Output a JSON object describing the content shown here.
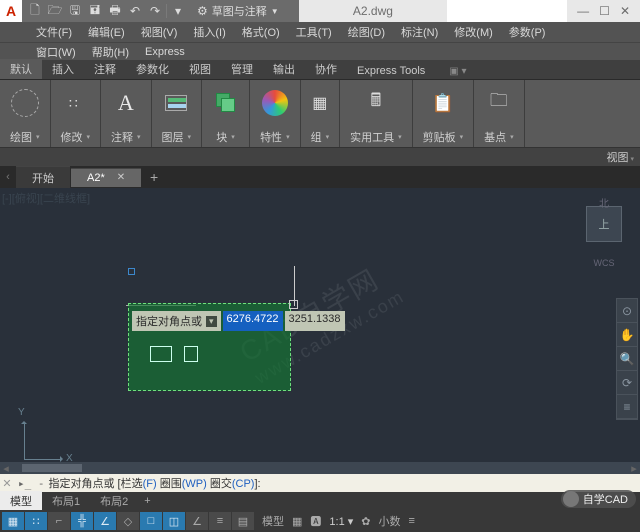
{
  "titlebar": {
    "mode_label": "草图与注释",
    "filename": "A2.dwg",
    "search_placeholder": ""
  },
  "menubar": {
    "items": [
      "文件(F)",
      "编辑(E)",
      "视图(V)",
      "插入(I)",
      "格式(O)",
      "工具(T)",
      "绘图(D)",
      "标注(N)",
      "修改(M)",
      "参数(P)"
    ],
    "row2": [
      "窗口(W)",
      "帮助(H)",
      "Express"
    ]
  },
  "ribbon": {
    "tabs": [
      "默认",
      "插入",
      "注释",
      "参数化",
      "视图",
      "管理",
      "输出",
      "协作",
      "Express Tools"
    ],
    "active_tab_index": 0,
    "panels": {
      "draw": "绘图",
      "modify": "修改",
      "annotate": "注释",
      "layer": "图层",
      "block": "块",
      "properties": "特性",
      "group": "组",
      "utilities": "实用工具",
      "clipboard": "剪贴板",
      "base": "基点"
    },
    "view_drop": "视图"
  },
  "doctabs": {
    "start": "开始",
    "active": "A2*"
  },
  "viewport": {
    "workspace_label": "[-][俯视][二维线框]",
    "viewcube_face": "上",
    "viewcube_north": "北",
    "wcs": "WCS",
    "ucs_x": "X",
    "ucs_y": "Y"
  },
  "dynamic_input": {
    "prompt": "指定对角点或",
    "value1": "6276.4722",
    "value2": "3251.1338"
  },
  "cmdline": {
    "text_pre": "指定对角点或 [",
    "opt_fence": "栏选",
    "opt_f_key": "(F)",
    "opt_wp": "圈围",
    "opt_wp_key": "(WP)",
    "opt_cp": "圈交",
    "opt_cp_key": "(CP)",
    "text_post": "]:"
  },
  "layouts": {
    "model": "模型",
    "layout1": "布局1",
    "layout2": "布局2"
  },
  "status": {
    "mode": "模型",
    "scale": "1:1",
    "zoom": "小数"
  },
  "account": {
    "name": "自学CAD"
  },
  "watermark": {
    "text1": "CAD自学网",
    "text2": "www.cadzxw.com"
  }
}
